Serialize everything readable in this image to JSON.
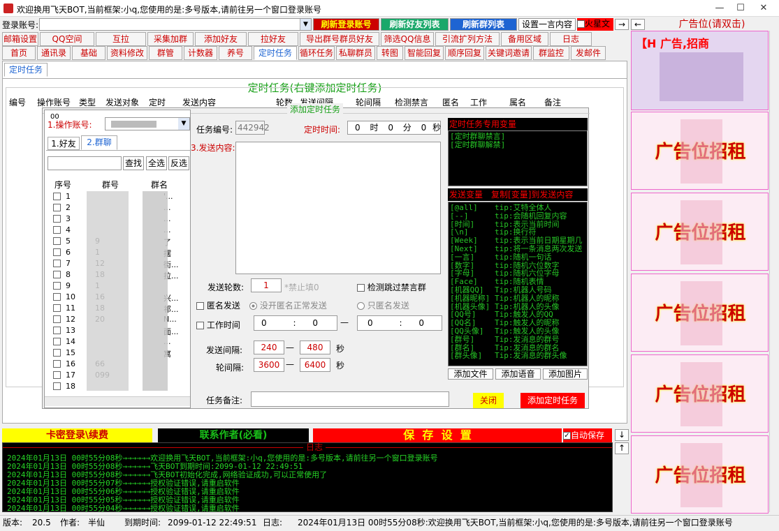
{
  "window": {
    "title": "欢迎换用飞天BOT,当前框架:小q,您使用的是:多号版本,请前往另一个窗口登录账号",
    "min": "—",
    "max": "☐",
    "close": "✕"
  },
  "topbar": {
    "login_label": "登录账号:",
    "btn_refresh_login": "刷新登录账号",
    "btn_refresh_friends": "刷新好友列表",
    "btn_refresh_groups": "刷新群列表",
    "btn_set_text": "设置一言内容",
    "star_label": "火星文",
    "arrow_right": "→",
    "arrow_left": "←",
    "ad_title": "广告位(请双击)"
  },
  "menu_row1": [
    "邮箱设置",
    "QQ空间",
    "互拉",
    "采集加群",
    "添加好友",
    "拉好友",
    "导出群号群员好友",
    "筛选QQ信息",
    "引流扩列方法",
    "备用区域",
    "日志"
  ],
  "menu_row2": [
    "首页",
    "通讯录",
    "基础",
    "资料修改",
    "群管",
    "计数器",
    "养号",
    "定时任务",
    "循环任务",
    "私聊群员",
    "转图",
    "智能回复",
    "顺序回复",
    "关键词邀请",
    "群监控",
    "发邮件"
  ],
  "subtab": "定时任务",
  "section_title": "定时任务(右键添加定时任务)",
  "table_headers": [
    "编号",
    "操作账号",
    "类型",
    "发送对象",
    "定时",
    "发送内容",
    "轮数",
    "发送间隔",
    "轮间隔",
    "检测禁言",
    "匿名",
    "工作",
    "属名",
    "备注"
  ],
  "dialog": {
    "title": "添加定时任务",
    "small_label": "00",
    "account_label": "1.操作账号:",
    "account_value": "",
    "tabs": [
      "1.好友",
      "2.群聊"
    ],
    "search_btn": "查找",
    "select_all_btn": "全选",
    "invert_btn": "反选",
    "list_headers": [
      "序号",
      "群号",
      "群名"
    ],
    "rows": [
      "1",
      "2",
      "3",
      "4",
      "5",
      "6",
      "7",
      "8",
      "9",
      "10",
      "11",
      "12",
      "13",
      "14",
      "15",
      "16",
      "17",
      "18"
    ],
    "row_groupnum": [
      "",
      "",
      "",
      "",
      "9",
      "1",
      "12",
      "18",
      "1",
      "16",
      "18",
      "20",
      "",
      "",
      "",
      "66",
      "099",
      ""
    ],
    "row_groupname": [
      "'...",
      "...",
      "...",
      "...",
      "了",
      "摆",
      "街...",
      "拉...",
      "",
      "兴...",
      "祁...",
      "N...",
      "面...",
      "...",
      "寓",
      "",
      "",
      ""
    ],
    "task_no_label": "任务编号:",
    "task_no": "442942",
    "time_label": "定时时间:",
    "time_h": "0",
    "time_h_unit": "时",
    "time_m": "0",
    "time_m_unit": "分",
    "time_s": "0",
    "time_s_unit": "秒",
    "content_label": "3.发送内容:",
    "var_hdr": "定时任务专用变量",
    "var_list": [
      "[定时群聊禁言]",
      "[定时群聊解禁]"
    ],
    "send_var_hdr": "发送变量",
    "copy_var_hdr": "复制[变量]到发送内容",
    "send_vars": [
      [
        "[@all]",
        "tip:艾特全体人"
      ],
      [
        "[--]",
        "tip:会随机回复内容"
      ],
      [
        "[时间]",
        "tip:表示当前时间"
      ],
      [
        "[\\n]",
        "tip:换行符"
      ],
      [
        "[Week]",
        "tip:表示当前日期星期几"
      ],
      [
        "[Next]",
        "tip:将一条消息两次发送"
      ],
      [
        "[一言]",
        "tip:随机一句话"
      ],
      [
        "[数字]",
        "tip:随机六位数字"
      ],
      [
        "[字母]",
        "tip:随机六位字母"
      ],
      [
        "[Face]",
        "tip:随机表情"
      ],
      [
        "[机器QQ]",
        "Tip:机器人号码"
      ],
      [
        "[机器昵称]",
        "Tip:机器人的昵称"
      ],
      [
        "[机器头像]",
        "Tip:机器人的头像"
      ],
      [
        "[QQ号]",
        "Tip:触发人的QQ"
      ],
      [
        "[QQ名]",
        "Tip:触发人的昵称"
      ],
      [
        "[QQ头像]",
        "Tip:触发人的头像"
      ],
      [
        "[群号]",
        "Tip:发消息的群号"
      ],
      [
        "[群名]",
        "Tip:发消息的群名"
      ],
      [
        "[群头像]",
        "Tip:发消息的群头像"
      ]
    ],
    "btn_add_file": "添加文件",
    "btn_add_voice": "添加语音",
    "btn_add_image": "添加图片",
    "rounds_label": "发送轮数:",
    "rounds": "1",
    "rounds_hint": "*禁止填0",
    "skip_mute_label": "检测跳过禁言群",
    "anon_label": "匿名发送",
    "anon_opt1": "没开匿名正常发送",
    "anon_opt2": "只匿名发送",
    "worktime_label": "工作时间",
    "wt_a": "0",
    "wt_b": "0",
    "wt_c": "0",
    "wt_d": "0",
    "colon": ":",
    "dash": "—",
    "interval_label": "发送间隔:",
    "interval_min": "240",
    "interval_max": "480",
    "sec": "秒",
    "round_interval_label": "轮间隔:",
    "round_min": "3600",
    "round_max": "6400",
    "remark_label": "任务备注:",
    "btn_close": "关闭",
    "btn_add_task": "添加定时任务"
  },
  "bottom": {
    "card_login": "卡密登录\\续费",
    "contact": "联系作者(必看)",
    "save": "保  存  设  置",
    "autosave": "自动保存",
    "down": "↓",
    "up": "↑"
  },
  "log": {
    "title": "日志",
    "lines": [
      "2024年01月13日 00时55分08秒→→→→→→欢迎换用飞天BOT,当前框架:小q,您使用的是:多号版本,请前往另一个窗口登录账号",
      "2024年01月13日 00时55分08秒→→→→→→飞天BOT到期时间:2099-01-12 22:49:51",
      "2024年01月13日 00时55分08秒→→→→→→飞天BOT初始化完成,网络验证成功,可以正常使用了",
      "2024年01月13日 00时55分07秒→→→→→→授权验证错误,请重启软件",
      "2024年01月13日 00时55分06秒→→→→→→授权验证错误,请重启软件",
      "2024年01月13日 00时55分05秒→→→→→→授权验证错误,请重启软件",
      "2024年01月13日 00时55分04秒→→→→→→授权验证错误,请重启软件"
    ]
  },
  "status": {
    "ver_label": "版本:",
    "ver": "20.5",
    "author_label": "作者:",
    "author": "半仙",
    "expire_label": "到期时间:",
    "expire": "2099-01-12 22:49:51",
    "log_label": "日志:",
    "log_msg": "2024年01月13日 00时55分08秒:欢迎换用飞天BOT,当前框架:小q,您使用的是:多号版本,请前往另一个窗口登录账号"
  },
  "ads": [
    "广告位招租",
    "广告位招租",
    "广告位招租",
    "广告位招租",
    "广告位招租"
  ],
  "ad_top": "【H 广告,招商",
  "colors": {
    "accent_red": "#ff0000",
    "green": "#19a019",
    "yellow": "#ffff00",
    "blue": "#1e64d2"
  }
}
